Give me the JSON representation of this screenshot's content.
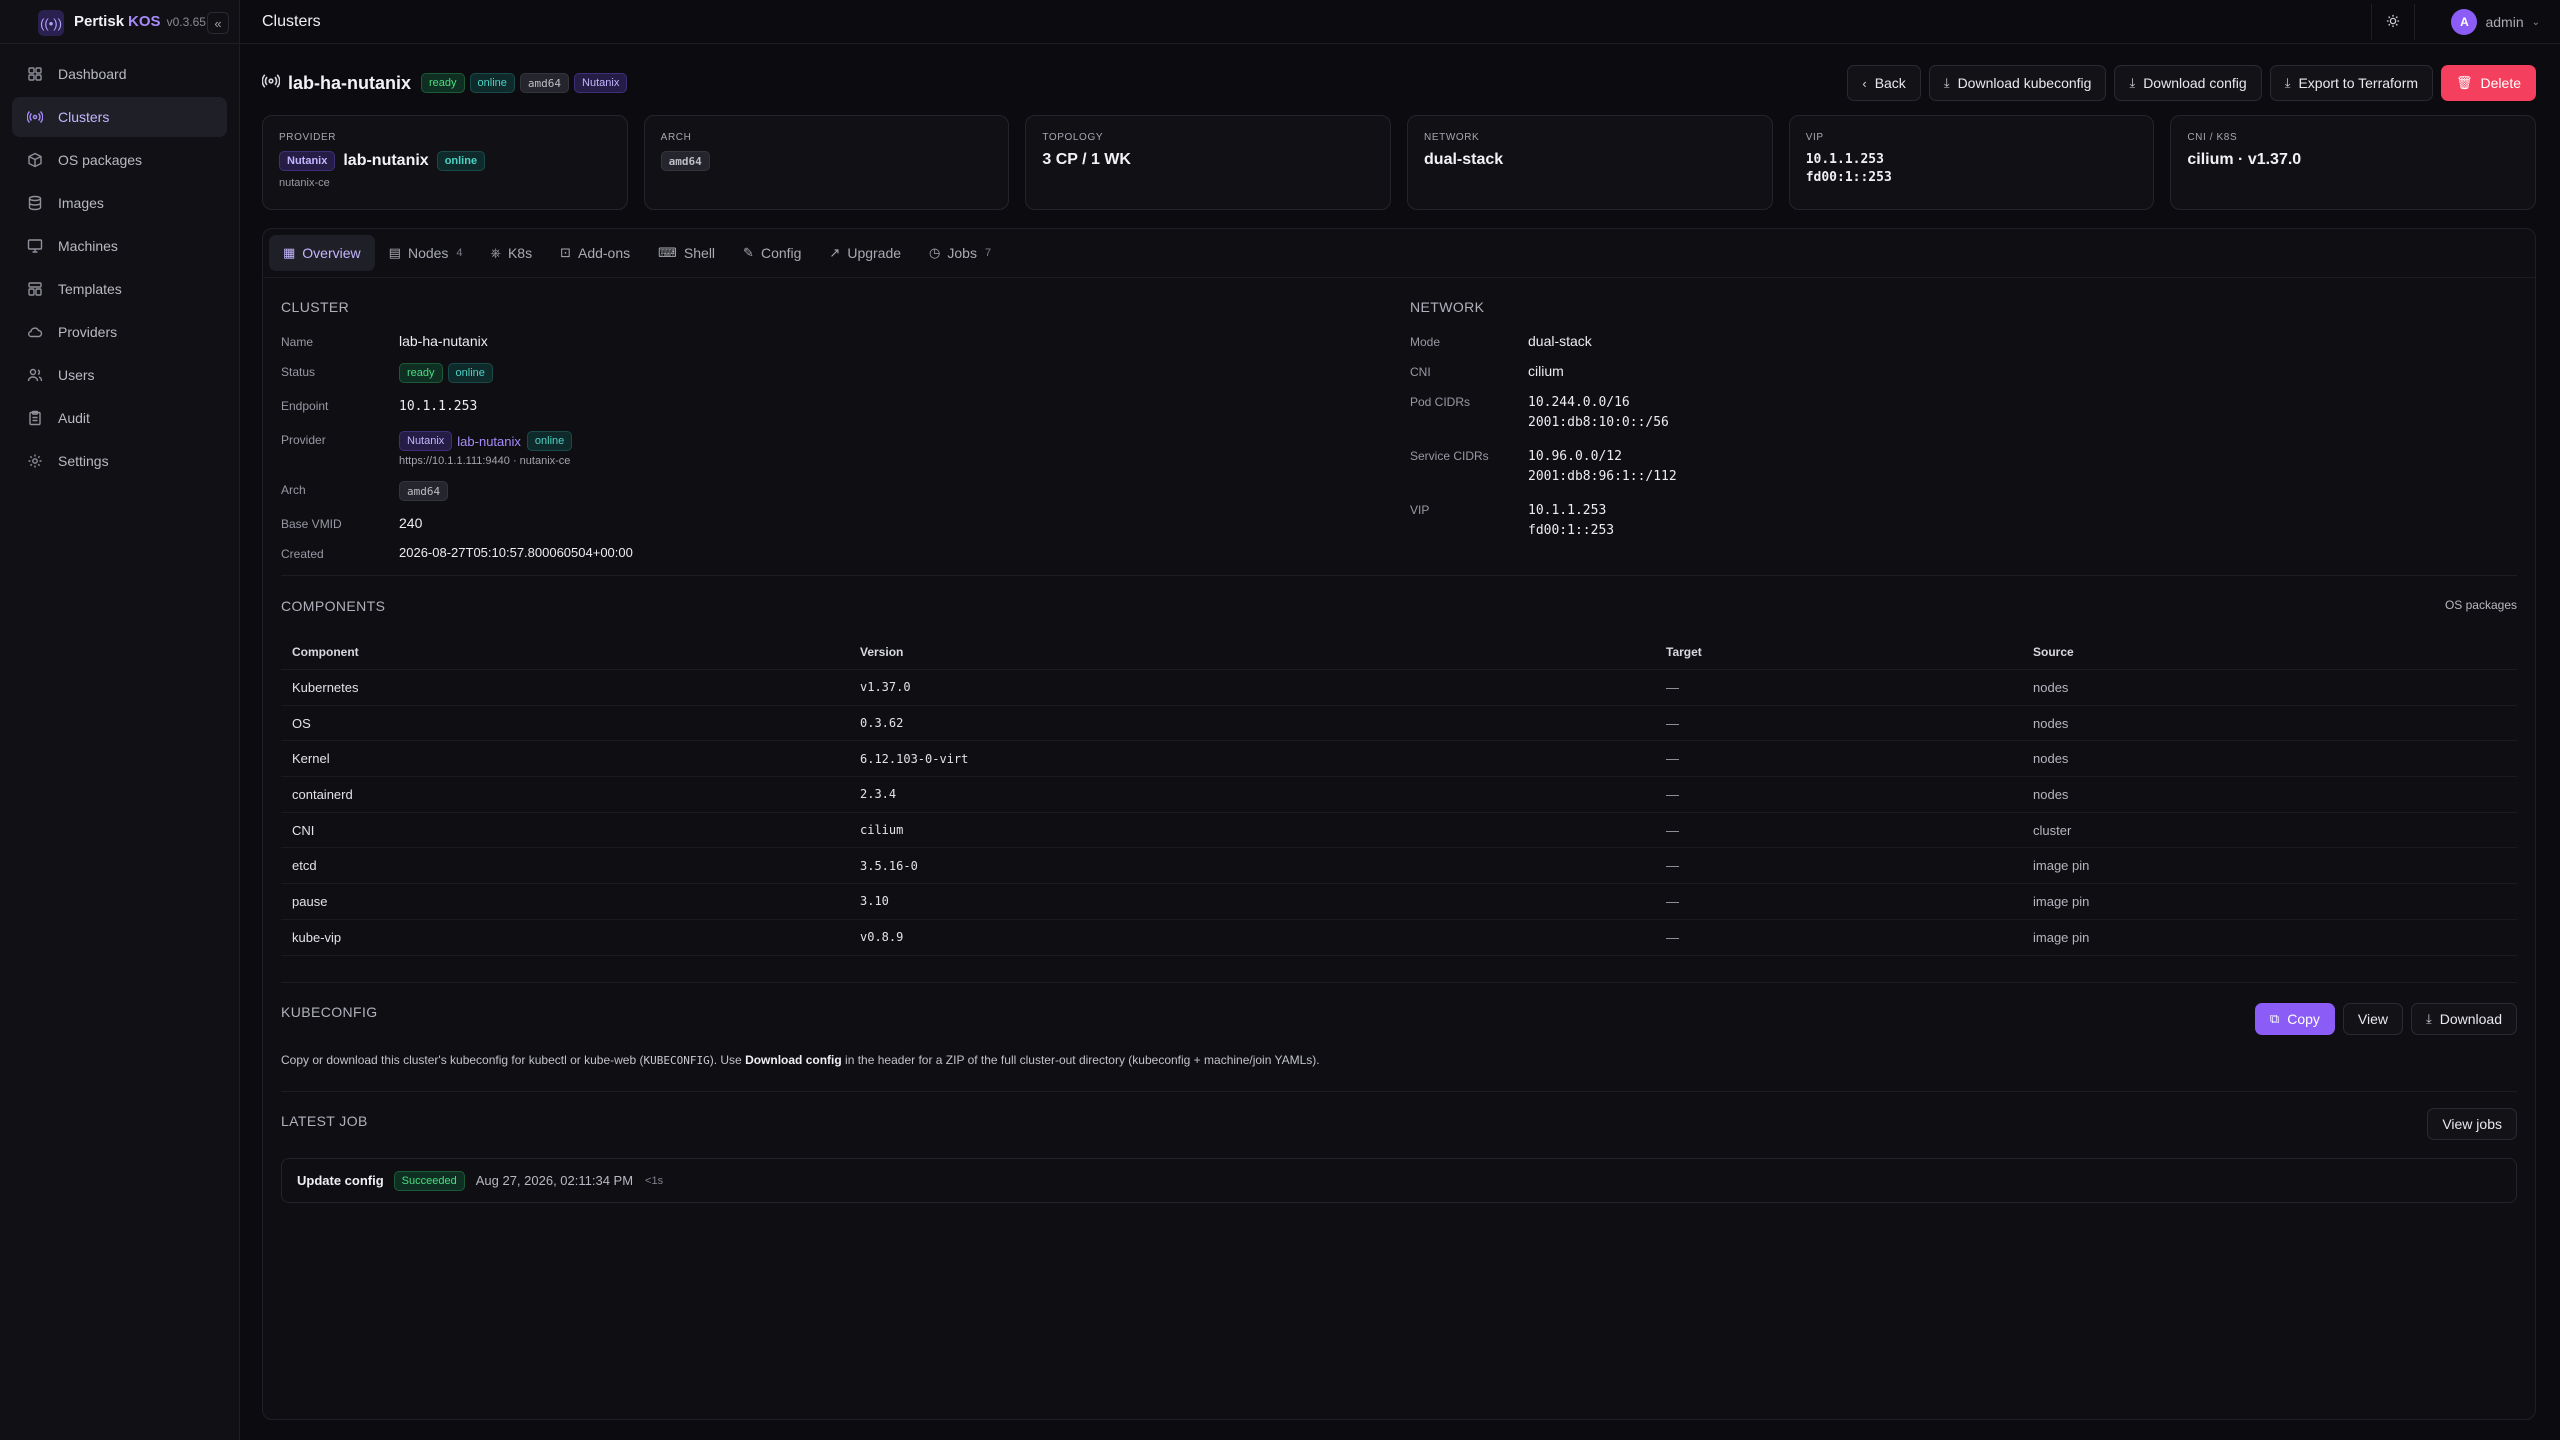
{
  "brand": {
    "name": "Pertisk",
    "accent": "KOS",
    "version": "v0.3.65"
  },
  "sidebar": {
    "items": [
      {
        "label": "Dashboard",
        "icon": "dashboard-icon"
      },
      {
        "label": "Clusters",
        "icon": "clusters-icon",
        "active": true
      },
      {
        "label": "OS packages",
        "icon": "package-icon"
      },
      {
        "label": "Images",
        "icon": "database-icon"
      },
      {
        "label": "Machines",
        "icon": "monitor-icon"
      },
      {
        "label": "Templates",
        "icon": "template-icon"
      },
      {
        "label": "Providers",
        "icon": "cloud-icon"
      },
      {
        "label": "Users",
        "icon": "users-icon"
      },
      {
        "label": "Audit",
        "icon": "clipboard-icon"
      },
      {
        "label": "Settings",
        "icon": "gear-icon"
      }
    ]
  },
  "topbar": {
    "title": "Clusters",
    "user": {
      "initial": "A",
      "name": "admin"
    }
  },
  "header": {
    "name": "lab-ha-nutanix",
    "badges": [
      "ready",
      "online",
      "amd64",
      "Nutanix"
    ],
    "actions": {
      "back": "Back",
      "download_kubeconfig": "Download kubeconfig",
      "download_config": "Download config",
      "export": "Export to Terraform",
      "delete": "Delete"
    }
  },
  "cards": {
    "provider": {
      "label": "PROVIDER",
      "badge": "Nutanix",
      "name": "lab-nutanix",
      "status": "online",
      "sub": "nutanix-ce"
    },
    "arch": {
      "label": "ARCH",
      "value": "amd64"
    },
    "topology": {
      "label": "TOPOLOGY",
      "value": "3 CP / 1 WK"
    },
    "network": {
      "label": "NETWORK",
      "value": "dual-stack"
    },
    "vip": {
      "label": "VIP",
      "v4": "10.1.1.253",
      "v6": "fd00:1::253"
    },
    "cni": {
      "label": "CNI / K8S",
      "value": "cilium · v1.37.0"
    }
  },
  "tabs": [
    {
      "label": "Overview",
      "icon": "grid-icon",
      "count": ""
    },
    {
      "label": "Nodes",
      "icon": "server-icon",
      "count": "4"
    },
    {
      "label": "K8s",
      "icon": "helm-icon",
      "count": ""
    },
    {
      "label": "Add-ons",
      "icon": "lock-icon",
      "count": ""
    },
    {
      "label": "Shell",
      "icon": "terminal-icon",
      "count": ""
    },
    {
      "label": "Config",
      "icon": "pencil-icon",
      "count": ""
    },
    {
      "label": "Upgrade",
      "icon": "trend-icon",
      "count": ""
    },
    {
      "label": "Jobs",
      "icon": "clock-icon",
      "count": "7"
    }
  ],
  "cluster": {
    "title": "CLUSTER",
    "name_label": "Name",
    "name": "lab-ha-nutanix",
    "status_label": "Status",
    "status_ready": "ready",
    "status_online": "online",
    "endpoint_label": "Endpoint",
    "endpoint": "10.1.1.253",
    "provider_label": "Provider",
    "provider_badge": "Nutanix",
    "provider_name": "lab-nutanix",
    "provider_status": "online",
    "provider_sub": "https://10.1.1.111:9440 · nutanix-ce",
    "arch_label": "Arch",
    "arch": "amd64",
    "vmid_label": "Base VMID",
    "vmid": "240",
    "created_label": "Created",
    "created": "2026-08-27T05:10:57.800060504+00:00"
  },
  "network": {
    "title": "NETWORK",
    "mode_label": "Mode",
    "mode": "dual-stack",
    "cni_label": "CNI",
    "cni": "cilium",
    "pod_label": "Pod CIDRs",
    "pod_v4": "10.244.0.0/16",
    "pod_v6": "2001:db8:10:0::/56",
    "svc_label": "Service CIDRs",
    "svc_v4": "10.96.0.0/12",
    "svc_v6": "2001:db8:96:1::/112",
    "vip_label": "VIP",
    "vip_v4": "10.1.1.253",
    "vip_v6": "fd00:1::253"
  },
  "components": {
    "title": "COMPONENTS",
    "link": "OS packages",
    "headers": [
      "Component",
      "Version",
      "Target",
      "Source"
    ],
    "rows": [
      [
        "Kubernetes",
        "v1.37.0",
        "—",
        "nodes"
      ],
      [
        "OS",
        "0.3.62",
        "—",
        "nodes"
      ],
      [
        "Kernel",
        "6.12.103-0-virt",
        "—",
        "nodes"
      ],
      [
        "containerd",
        "2.3.4",
        "—",
        "nodes"
      ],
      [
        "CNI",
        "cilium",
        "—",
        "cluster"
      ],
      [
        "etcd",
        "3.5.16-0",
        "—",
        "image pin"
      ],
      [
        "pause",
        "3.10",
        "—",
        "image pin"
      ],
      [
        "kube-vip",
        "v0.8.9",
        "—",
        "image pin"
      ]
    ]
  },
  "kubeconfig": {
    "title": "KUBECONFIG",
    "copy": "Copy",
    "view": "View",
    "download": "Download",
    "desc_1": "Copy or download this cluster's kubeconfig for kubectl or kube-web (",
    "desc_code": "KUBECONFIG",
    "desc_2": "). Use ",
    "desc_bold": "Download config",
    "desc_3": " in the header for a ZIP of the full cluster-out directory (kubeconfig + machine/join YAMLs)."
  },
  "latest_job": {
    "title": "LATEST JOB",
    "view_jobs": "View jobs",
    "name": "Update config",
    "status": "Succeeded",
    "time": "Aug 27, 2026, 02:11:34 PM",
    "duration": "<1s"
  },
  "colors": {
    "accent": "#8b5cf6",
    "danger": "#f43f5e",
    "success": "#4ade80"
  }
}
